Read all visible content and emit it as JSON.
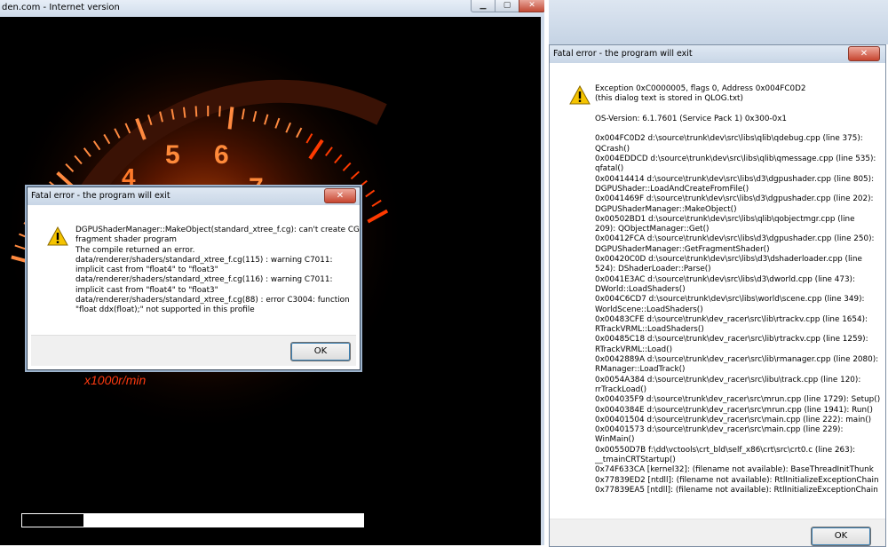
{
  "left_window": {
    "title": "den.com - Internet version",
    "progress": 0.18,
    "tacho": {
      "numbers": [
        "4",
        "5",
        "6",
        "7"
      ],
      "unit_label": "x1000r/min"
    }
  },
  "small_dialog": {
    "title": "Fatal error - the program will exit",
    "close_label": "✕",
    "message": [
      "DGPUShaderManager::MakeObject(standard_xtree_f.cg): can't create CG",
      "fragment shader program",
      "The compile returned an error.",
      "data/renderer/shaders/standard_xtree_f.cg(115) : warning C7011:",
      "implicit cast from \"float4\" to \"float3\"",
      "data/renderer/shaders/standard_xtree_f.cg(116) : warning C7011:",
      "implicit cast from \"float4\" to \"float3\"",
      "data/renderer/shaders/standard_xtree_f.cg(88) : error C3004: function",
      "\"float ddx(float);\" not supported in this profile"
    ],
    "ok_label": "OK"
  },
  "right_dialog": {
    "title": "Fatal error - the program will exit",
    "close_label": "✕",
    "message": [
      "Exception 0xC0000005, flags 0, Address 0x004FC0D2",
      "(this dialog text is stored in QLOG.txt)",
      "",
      "OS-Version: 6.1.7601 (Service Pack 1) 0x300-0x1",
      "",
      "0x004FC0D2 d:\\source\\trunk\\dev\\src\\libs\\qlib\\qdebug.cpp (line 375):",
      "QCrash()",
      "0x004EDDCD d:\\source\\trunk\\dev\\src\\libs\\qlib\\qmessage.cpp (line 535):",
      "qfatal()",
      "0x00414414 d:\\source\\trunk\\dev\\src\\libs\\d3\\dgpushader.cpp (line 805):",
      "DGPUShader::LoadAndCreateFromFile()",
      "0x0041469F d:\\source\\trunk\\dev\\src\\libs\\d3\\dgpushader.cpp (line 202):",
      "DGPUShaderManager::MakeObject()",
      "0x00502BD1 d:\\source\\trunk\\dev\\src\\libs\\qlib\\qobjectmgr.cpp (line",
      "209): QObjectManager::Get()",
      "0x00412FCA d:\\source\\trunk\\dev\\src\\libs\\d3\\dgpushader.cpp (line 250):",
      "DGPUShaderManager::GetFragmentShader()",
      "0x00420C0D d:\\source\\trunk\\dev\\src\\libs\\d3\\dshaderloader.cpp (line",
      "524): DShaderLoader::Parse()",
      "0x0041E3AC d:\\source\\trunk\\dev\\src\\libs\\d3\\dworld.cpp (line 473):",
      "DWorld::LoadShaders()",
      "0x004C6CD7 d:\\source\\trunk\\dev\\src\\libs\\world\\scene.cpp (line 349):",
      "WorldScene::LoadShaders()",
      "0x00483CFE d:\\source\\trunk\\dev_racer\\src\\lib\\rtrackv.cpp (line 1654):",
      "RTrackVRML::LoadShaders()",
      "0x00485C18 d:\\source\\trunk\\dev_racer\\src\\lib\\rtrackv.cpp (line 1259):",
      "RTrackVRML::Load()",
      "0x0042889A d:\\source\\trunk\\dev_racer\\src\\lib\\rmanager.cpp (line 2080):",
      "RManager::LoadTrack()",
      "0x0054A384 d:\\source\\trunk\\dev_racer\\src\\libu\\track.cpp (line 120):",
      "rrTrackLoad()",
      "0x004035F9 d:\\source\\trunk\\dev_racer\\src\\mrun.cpp (line 1729): Setup()",
      "0x0040384E d:\\source\\trunk\\dev_racer\\src\\mrun.cpp (line 1941): Run()",
      "0x00401504 d:\\source\\trunk\\dev_racer\\src\\main.cpp (line 222): main()",
      "0x00401573 d:\\source\\trunk\\dev_racer\\src\\main.cpp (line 229):",
      "WinMain()",
      "0x00550D7B f:\\dd\\vctools\\crt_bld\\self_x86\\crt\\src\\crt0.c (line 263):",
      "__tmainCRTStartup()",
      "0x74F633CA [kernel32]: (filename not available): BaseThreadInitThunk",
      "0x77839ED2 [ntdll]: (filename not available): RtlInitializeExceptionChain",
      "0x77839EA5 [ntdll]: (filename not available): RtlInitializeExceptionChain"
    ],
    "ok_label": "OK"
  },
  "colors": {
    "tacho_glow": "#ff5a00",
    "warning_yellow": "#f5c400"
  }
}
